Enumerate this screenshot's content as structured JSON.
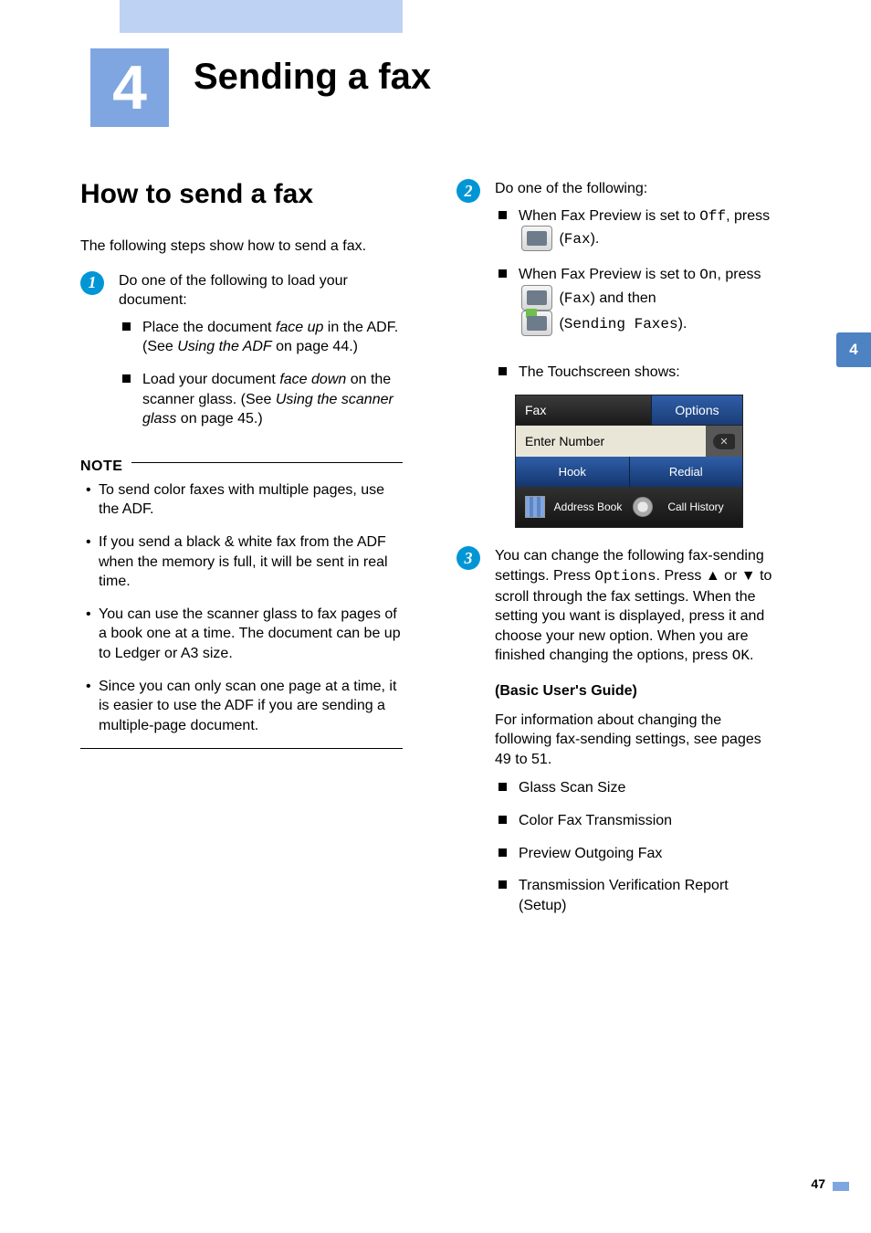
{
  "chapter": {
    "number": "4",
    "title": "Sending a fax"
  },
  "tab": "4",
  "left": {
    "heading": "How to send a fax",
    "intro": "The following steps show how to send a fax.",
    "step1": {
      "lead": "Do one of the following to load your document:",
      "bullets": {
        "adf_pre": "Place the document ",
        "adf_face": "face up",
        "adf_mid": " in the ADF. (See ",
        "adf_link": "Using the ADF",
        "adf_post": " on page 44.)",
        "glass_pre": "Load your document ",
        "glass_face": "face down",
        "glass_mid": " on the scanner glass. (See ",
        "glass_link": "Using the scanner glass",
        "glass_post": " on page 45.)"
      }
    },
    "note": {
      "title": "NOTE",
      "items": {
        "n1": "To send color faxes with multiple pages, use the ADF.",
        "n2": "If you send a black & white fax from the ADF when the memory is full, it will be sent in real time.",
        "n3": "You can use the scanner glass to fax pages of a book one at a time. The document can be up to Ledger or A3 size.",
        "n4": "Since you can only scan one page at a time, it is easier to use the ADF if you are sending a multiple-page document."
      }
    }
  },
  "right": {
    "step2": {
      "lead": "Do one of the following:",
      "off_pre": "When Fax Preview is set to ",
      "off_val": "Off",
      "off_post": ", press ",
      "fax_label": "Fax",
      "off_end": ").",
      "on_pre": "When Fax Preview is set to ",
      "on_val": "On",
      "on_post": ", press ",
      "on_fax_post": ") and then",
      "send_label": "Sending Faxes",
      "send_end": ").",
      "ts_caption": "The Touchscreen shows:"
    },
    "ts": {
      "fax": "Fax",
      "options": "Options",
      "enter": "Enter Number",
      "x": "✕",
      "hook": "Hook",
      "redial": "Redial",
      "ab": "Address Book",
      "ch": "Call History"
    },
    "step3": {
      "body_pre": "You can change the following fax-sending settings. Press ",
      "options": "Options",
      "body_mid1": ". Press ",
      "up": "▲",
      "or": " or ",
      "down": "▼",
      "body_mid2": " to scroll through the fax settings. When the setting you want is displayed, press it and choose your new option. When you are finished changing the options, press ",
      "ok": "OK",
      "body_end": ".",
      "guide": "(Basic User's Guide)",
      "guide_body": "For information about changing the following fax-sending settings, see pages 49 to 51.",
      "bullets": {
        "b1": "Glass Scan Size",
        "b2": "Color Fax Transmission",
        "b3": "Preview Outgoing Fax",
        "b4": "Transmission Verification Report (Setup)"
      }
    }
  },
  "page_number": "47"
}
